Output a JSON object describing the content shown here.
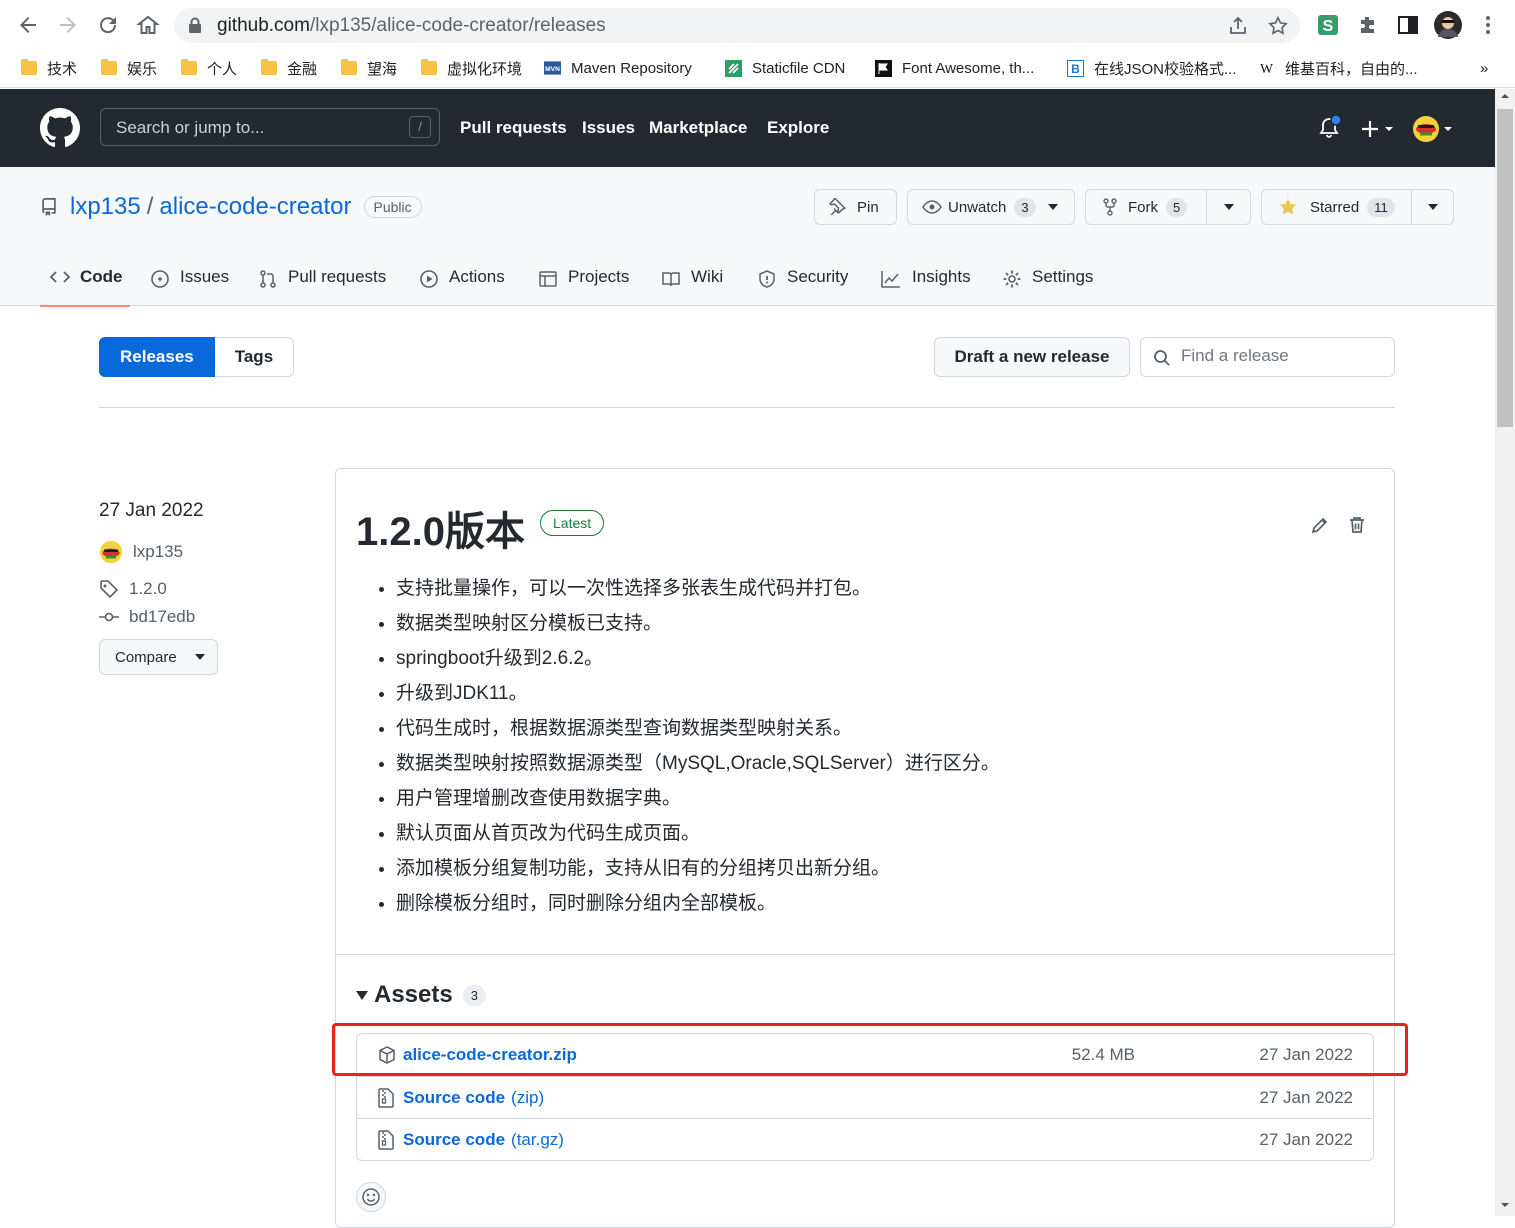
{
  "browser": {
    "url_host": "github.com",
    "url_path": "/lxp135/alice-code-creator/releases",
    "bookmarks": [
      {
        "label": "技术",
        "icon": "folder-icon"
      },
      {
        "label": "娱乐",
        "icon": "folder-icon"
      },
      {
        "label": "个人",
        "icon": "folder-icon"
      },
      {
        "label": "金融",
        "icon": "folder-icon"
      },
      {
        "label": "望海",
        "icon": "folder-icon"
      },
      {
        "label": "虚拟化环境",
        "icon": "folder-icon"
      },
      {
        "label": "Maven Repository",
        "icon": "maven-icon"
      },
      {
        "label": "Staticfile CDN",
        "icon": "staticfile-icon"
      },
      {
        "label": "Font Awesome, th...",
        "icon": "flag-icon"
      },
      {
        "label": "在线JSON校验格式...",
        "icon": "bejson-icon"
      },
      {
        "label": "维基百科，自由的...",
        "icon": "wikipedia-icon"
      }
    ],
    "more_bookmarks": "»"
  },
  "gh_header": {
    "search_placeholder": "Search or jump to...",
    "search_shortcut": "/",
    "nav": [
      "Pull requests",
      "Issues",
      "Marketplace",
      "Explore"
    ]
  },
  "repo": {
    "owner": "lxp135",
    "name": "alice-code-creator",
    "visibility": "Public",
    "pin_label": "Pin",
    "unwatch_label": "Unwatch",
    "watch_count": "3",
    "fork_label": "Fork",
    "fork_count": "5",
    "starred_label": "Starred",
    "star_count": "11",
    "tabs": [
      "Code",
      "Issues",
      "Pull requests",
      "Actions",
      "Projects",
      "Wiki",
      "Security",
      "Insights",
      "Settings"
    ]
  },
  "releases_page": {
    "tab_releases": "Releases",
    "tab_tags": "Tags",
    "draft_label": "Draft a new release",
    "find_placeholder": "Find a release"
  },
  "release": {
    "date": "27 Jan 2022",
    "author": "lxp135",
    "tag": "1.2.0",
    "commit": "bd17edb",
    "compare_label": "Compare",
    "title": "1.2.0版本",
    "latest_label": "Latest",
    "notes": [
      "支持批量操作，可以一次性选择多张表生成代码并打包。",
      "数据类型映射区分模板已支持。",
      "springboot升级到2.6.2。",
      "升级到JDK11。",
      "代码生成时，根据数据源类型查询数据类型映射关系。",
      "数据类型映射按照数据源类型（MySQL,Oracle,SQLServer）进行区分。",
      "用户管理增删改查使用数据字典。",
      "默认页面从首页改为代码生成页面。",
      "添加模板分组复制功能，支持从旧有的分组拷贝出新分组。",
      "删除模板分组时，同时删除分组内全部模板。"
    ],
    "assets_label": "Assets",
    "assets_count": "3",
    "assets": [
      {
        "name": "alice-code-creator.zip",
        "ext": "",
        "size": "52.4 MB",
        "date": "27 Jan 2022",
        "icon": "package-icon"
      },
      {
        "name": "Source code",
        "ext": "(zip)",
        "size": "",
        "date": "27 Jan 2022",
        "icon": "file-zip-icon"
      },
      {
        "name": "Source code",
        "ext": "(tar.gz)",
        "size": "",
        "date": "27 Jan 2022",
        "icon": "file-zip-icon"
      }
    ]
  },
  "colors": {
    "header_bg": "#24292f",
    "link": "#0969da",
    "latest_green": "#1a7f37",
    "tab_underline": "#fd8c73",
    "highlight_box": "#e8241c"
  }
}
